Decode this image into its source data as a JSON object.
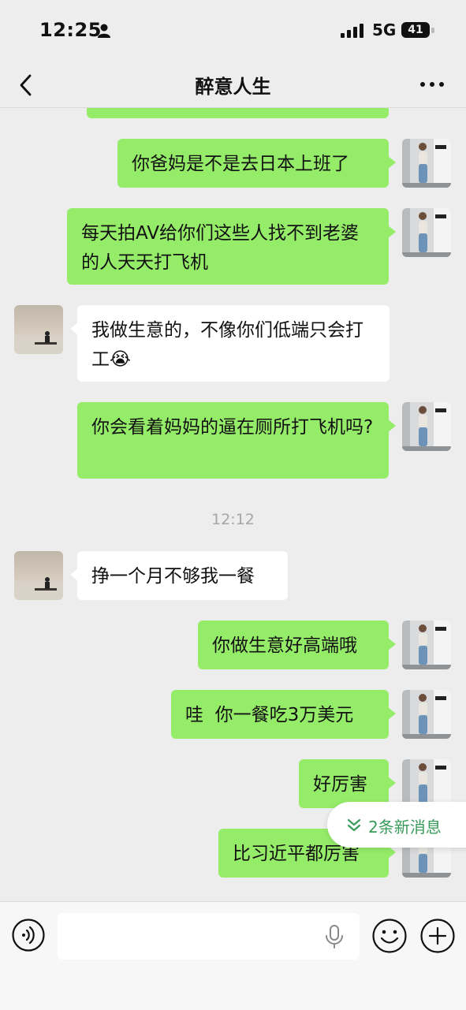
{
  "status": {
    "time": "12:25",
    "network": "5G",
    "battery": "41"
  },
  "header": {
    "title": "醉意人生"
  },
  "messages": [
    {
      "from": "me",
      "text": ""
    },
    {
      "from": "me",
      "text": "你爸妈是不是去日本上班了"
    },
    {
      "from": "me",
      "text": "每天拍AV给你们这些人找不到老婆的人天天打飞机"
    },
    {
      "from": "other",
      "text": "我做生意的，不像你们低端只会打工😭"
    },
    {
      "from": "me",
      "text": "你会看着妈妈的逼在厕所打飞机吗?"
    },
    {
      "from": "other",
      "text": "挣一个月不够我一餐"
    },
    {
      "from": "me",
      "text": "你做生意好高端哦"
    },
    {
      "from": "me",
      "text": "哇  你一餐吃3万美元"
    },
    {
      "from": "me",
      "text": "好厉害"
    },
    {
      "from": "me",
      "text": "比习近平都厉害"
    }
  ],
  "timestamps": [
    "12:12"
  ],
  "new_messages": {
    "label": "2条新消息"
  },
  "input": {
    "value": "",
    "placeholder": ""
  },
  "colors": {
    "my_bubble": "#95ec69",
    "other_bubble": "#ffffff",
    "background": "#ededed",
    "accent": "#3a9a5a"
  },
  "icons": {
    "back": "chevron-left-icon",
    "more": "more-dots-icon",
    "voice": "voice-icon",
    "mic": "microphone-icon",
    "emoji": "emoji-icon",
    "plus": "plus-icon",
    "new_messages": "double-chevron-down-icon"
  }
}
